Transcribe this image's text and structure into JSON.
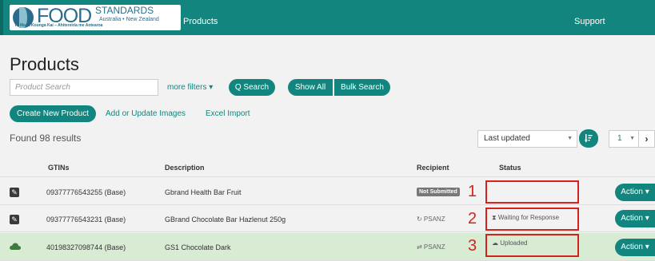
{
  "header": {
    "logo": {
      "wordmark": "FOOD",
      "wordmark_suffix": "STANDARDS",
      "region": "Australia • New Zealand",
      "tagline": "Te Mana Kounga Kai – Ahitereiria me Aotearoa"
    },
    "nav_products": "Products",
    "nav_support": "Support",
    "colors": {
      "brand": "#12867e",
      "alert": "#d6221f"
    }
  },
  "page_title": "Products",
  "toolbar": {
    "search_placeholder": "Product Search",
    "more_filters_label": "more filters ▾",
    "search_button": "Q Search",
    "show_all_button": "Show All",
    "bulk_search_button": "Bulk Search",
    "create_button": "Create New Product",
    "add_images_link": "Add or Update Images",
    "excel_import_link": "Excel Import"
  },
  "results": {
    "found_text": "Found 98 results",
    "sort_selected": "Last updated",
    "sort_icon": "sort-icon",
    "page_selected": "1",
    "next_label": "›"
  },
  "table": {
    "headers": {
      "gtins": "GTINs",
      "description": "Description",
      "recipient": "Recipient",
      "status": "Status"
    },
    "rows": [
      {
        "icon": "edit-icon",
        "gtin": "09377776543255 (Base)",
        "description": "Gbrand Health Bar Fruit",
        "recipient": "Not Submitted",
        "status": "",
        "annotation": "1",
        "action": "Action ▾"
      },
      {
        "icon": "edit-icon",
        "gtin": "09377776543231 (Base)",
        "description": "GBrand Chocolate Bar Hazlenut 250g",
        "recipient": "↻ PSANZ",
        "status": "⧗ Waiting for Response",
        "annotation": "2",
        "action": "Action ▾"
      },
      {
        "icon": "cloud-icon",
        "gtin": "40198327098744 (Base)",
        "description": "GS1 Chocolate Dark",
        "recipient": "⇄ PSANZ",
        "status": "☁ Uploaded",
        "annotation": "3",
        "action": "Action ▾"
      }
    ]
  }
}
